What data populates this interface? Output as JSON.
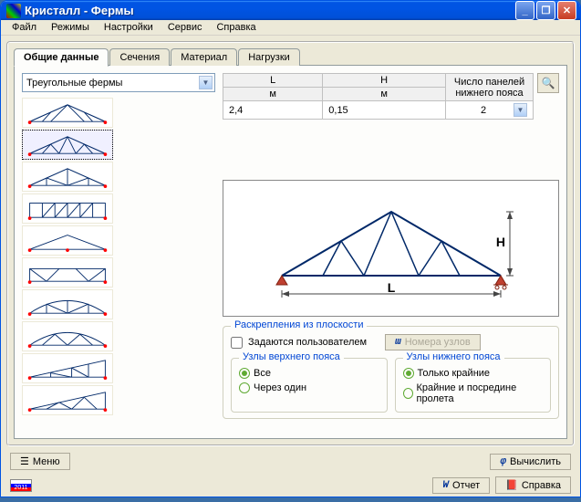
{
  "title": "Кристалл - Фермы",
  "menu": {
    "file": "Файл",
    "modes": "Режимы",
    "settings": "Настройки",
    "service": "Сервис",
    "help": "Справка"
  },
  "tabs": {
    "general": "Общие данные",
    "sections": "Сечения",
    "material": "Материал",
    "loads": "Нагрузки"
  },
  "combo": {
    "value": "Треугольные фермы"
  },
  "table": {
    "L": "L",
    "H": "H",
    "m": "м",
    "panels": "Число панелей нижнего пояса",
    "Lval": "2,4",
    "Hval": "0,15",
    "panelsval": "2"
  },
  "preview": {
    "L": "L",
    "H": "H"
  },
  "group": {
    "bracing": "Раскрепления из плоскости",
    "userdef": "Задаются пользователем",
    "nodenum": "Номера узлов",
    "upper": "Узлы верхнего пояса",
    "lower": "Узлы нижнего пояса",
    "all": "Все",
    "every2": "Через один",
    "endsonly": "Только крайние",
    "endsmid": "Крайние и посредине пролета"
  },
  "bottom": {
    "menu": "Меню",
    "calc": "Вычислить",
    "report": "Отчет",
    "help": "Справка",
    "year": "2011"
  }
}
